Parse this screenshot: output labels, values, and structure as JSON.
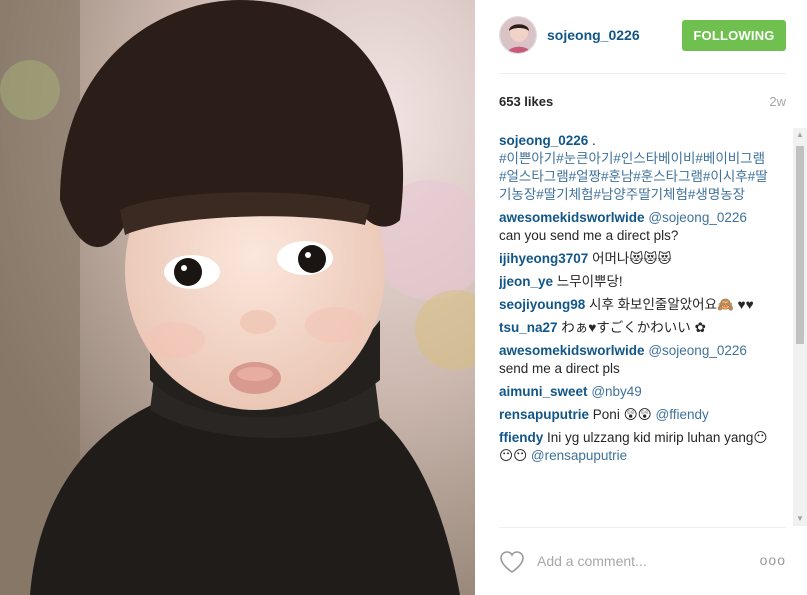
{
  "post": {
    "username": "sojeong_0226",
    "follow_label": "FOLLOWING",
    "likes": "653 likes",
    "time": "2w",
    "follow_color": "#70c050"
  },
  "caption": {
    "user": "sojeong_0226",
    "text": " .",
    "tags": "#이쁜아기#눈큰아기#인스타베이비#베이비그램#얼스타그램#얼짱#훈남#훈스타그램#이시후#딸기농장#딸기체험#남양주딸기체험#생명농장"
  },
  "comments": [
    {
      "user": "awesomekidsworlwide",
      "mention": "@sojeong_0226",
      "text": "can you send me a direct pls?"
    },
    {
      "user": "ijihyeong3707",
      "mention": "",
      "text": "어머나😻😻😻"
    },
    {
      "user": "jjeon_ye",
      "mention": "",
      "text": "느무이뿌당!"
    },
    {
      "user": "seojiyoung98",
      "mention": "",
      "text": "시후 화보인줄알았어요🙈 ♥♥"
    },
    {
      "user": "tsu_na27",
      "mention": "",
      "text": "わぁ♥すごくかわいい ✿"
    },
    {
      "user": "awesomekidsworlwide",
      "mention": "@sojeong_0226",
      "text": "send me a direct pls"
    },
    {
      "user": "aimuni_sweet",
      "mention": "@nby49",
      "text": ""
    },
    {
      "user": "rensapuputrie",
      "mention": "@ffiendy",
      "text": "Poni 😲😲"
    },
    {
      "user": "ffiendy",
      "mention": "@rensapuputrie",
      "text": "Ini yg ulzzang kid mirip luhan yang😶😶😶"
    }
  ],
  "footer": {
    "placeholder": "Add a comment...",
    "more": "ooo"
  }
}
